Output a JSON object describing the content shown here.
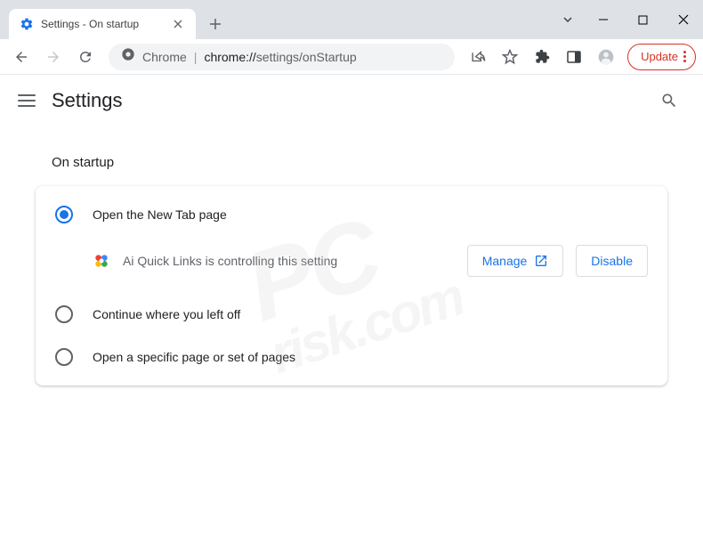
{
  "tab": {
    "title": "Settings - On startup"
  },
  "omnibox": {
    "scheme_label": "Chrome",
    "host": "chrome://",
    "path": "settings/onStartup"
  },
  "update_button": {
    "label": "Update"
  },
  "header": {
    "title": "Settings"
  },
  "section": {
    "title": "On startup"
  },
  "startup": {
    "options": [
      {
        "label": "Open the New Tab page",
        "selected": true
      },
      {
        "label": "Continue where you left off",
        "selected": false
      },
      {
        "label": "Open a specific page or set of pages",
        "selected": false
      }
    ],
    "extension_notice": {
      "text": "Ai Quick Links is controlling this setting",
      "manage_label": "Manage",
      "disable_label": "Disable"
    }
  },
  "watermark": {
    "line1": "PC",
    "line2": "risk.com"
  }
}
